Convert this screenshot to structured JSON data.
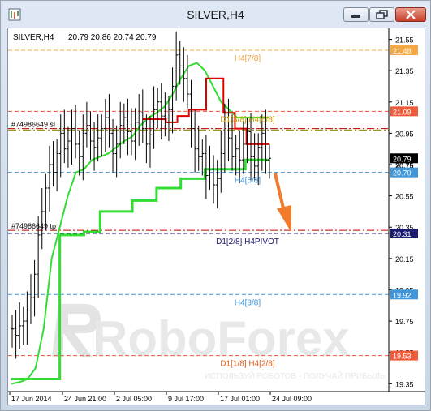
{
  "window": {
    "title": "SILVER,H4"
  },
  "chart_header": {
    "symbol": "SILVER,H4",
    "ohlc": "20.79 20.86 20.74 20.79"
  },
  "watermark": {
    "brand": "RoboForex",
    "tagline": "ИСПОЛЬЗУЙ РОБОТОВ - ПОЛУЧАЙ ПРИБЫЛЬ"
  },
  "chart_data": {
    "type": "bar",
    "symbol": "SILVER",
    "timeframe": "H4",
    "ylim": [
      19.3,
      21.62
    ],
    "y_ticks": [
      "21.55",
      "21.35",
      "21.15",
      "20.95",
      "20.75",
      "20.55",
      "20.35",
      "20.15",
      "19.95",
      "19.75",
      "19.55",
      "19.35"
    ],
    "x_ticks": [
      "17 Jun 2014",
      "24 Jun 21:00",
      "2 Jul 05:00",
      "9 Jul 17:00",
      "17 Jul 01:00",
      "24 Jul 09:00"
    ],
    "levels": [
      {
        "label": "H4[7/8]",
        "price": 21.48,
        "price_label": "21.48",
        "color": "#f4a742",
        "label_color": "#e8a040"
      },
      {
        "label": "D1[3/8] H4[6/8]",
        "price": 21.09,
        "price_label": "21.09",
        "color": "#ef5b3a",
        "label_color": "#c9a000"
      },
      {
        "label": "H4[5/8]",
        "price": 20.7,
        "price_label": "20.70",
        "color": "#3f96d8",
        "label_color": "#3f96d8"
      },
      {
        "label": "D1[2/8] H4PIVOT",
        "price": 20.31,
        "price_label": "20.31",
        "color": "#1c1a6e",
        "label_color": "#1c1a6e"
      },
      {
        "label": "H4[3/8]",
        "price": 19.92,
        "price_label": "19.92",
        "color": "#3f96d8",
        "label_color": "#3f96d8"
      },
      {
        "label": "D1[1/8] H4[2/8]",
        "price": 19.53,
        "price_label": "19.53",
        "color": "#ef5b3a",
        "label_color": "#e86020"
      }
    ],
    "current_price": {
      "value": 20.79,
      "label": "20.79"
    },
    "hidden_price_label": "20.75",
    "orders": [
      {
        "label": "#74986649 sl",
        "price": 20.98,
        "color": "#c20000"
      },
      {
        "label": "#74986649 tp",
        "price": 20.33,
        "color": "#c20000"
      }
    ],
    "series": [
      {
        "name": "ohlc",
        "values": [
          19.7,
          19.66,
          19.72,
          19.75,
          19.82,
          19.9,
          20.05,
          20.3,
          20.45,
          20.6,
          20.75,
          20.7,
          20.82,
          20.95,
          20.85,
          20.9,
          20.98,
          20.88,
          20.8,
          20.95,
          21.0,
          20.9,
          20.86,
          20.92,
          20.98,
          21.05,
          20.95,
          20.82,
          20.88,
          21.0,
          21.05,
          20.96,
          20.9,
          21.02,
          21.08,
          20.98,
          20.88,
          20.94,
          21.1,
          21.15,
          21.06,
          21.02,
          21.1,
          21.25,
          21.45,
          21.38,
          21.3,
          21.2,
          20.98,
          20.85,
          20.8,
          20.82,
          20.68,
          20.72,
          20.62,
          20.66,
          20.82,
          21.05,
          20.92,
          20.8,
          20.85,
          20.78,
          20.88,
          20.96,
          20.8,
          20.74,
          20.86,
          20.95,
          20.78,
          20.79
        ]
      },
      {
        "name": "trail-green",
        "values": [
          19.35,
          19.36,
          19.38,
          19.45,
          19.7,
          20.15,
          20.35,
          20.55,
          20.7,
          20.72,
          20.78,
          20.8,
          20.82,
          20.86,
          20.9,
          20.93,
          21.0,
          21.05,
          21.08,
          21.12,
          21.2,
          21.3,
          21.38,
          21.4,
          21.35,
          21.25,
          21.15,
          21.1,
          21.05,
          21.05,
          21.05,
          21.05,
          21.05
        ]
      },
      {
        "name": "step-green-low",
        "values": [
          19.38,
          19.38,
          19.38,
          19.38,
          19.38,
          19.38,
          20.3,
          20.3,
          20.3,
          20.32,
          20.32,
          20.45,
          20.45,
          20.45,
          20.45,
          20.52,
          20.52,
          20.52,
          20.6,
          20.6,
          20.6,
          20.66,
          20.66,
          20.66,
          20.72,
          20.72,
          20.72,
          20.72,
          20.72,
          20.78,
          20.78,
          20.78,
          20.78
        ]
      },
      {
        "name": "step-red",
        "values": [
          21.04,
          21.04,
          21.04,
          21.04,
          21.02,
          21.02,
          21.06,
          21.06,
          21.1,
          21.1,
          21.1,
          21.3,
          21.3,
          21.3,
          21.08,
          21.08,
          20.98,
          20.98,
          20.88,
          20.88,
          20.88,
          20.88,
          20.88
        ]
      }
    ]
  }
}
